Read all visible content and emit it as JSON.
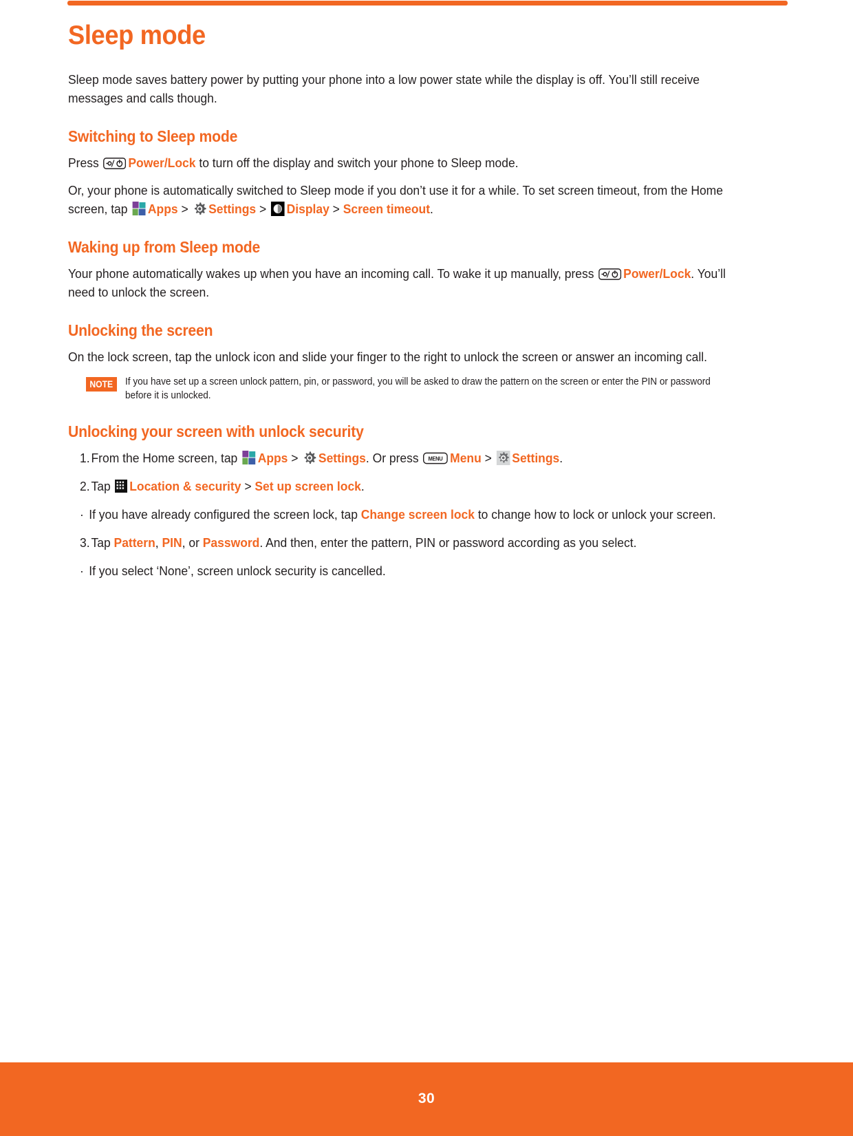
{
  "theme": {
    "accent": "#f26722",
    "text": "#231f20",
    "page_bg": "#ffffff"
  },
  "header": {
    "rule": "orange-top-rule"
  },
  "title": "Sleep mode",
  "intro": "Sleep mode saves battery power by putting your phone into a low power state while the display is off.  You’ll still receive messages and calls though.",
  "sections": [
    {
      "heading": "Switching to Sleep mode",
      "paragraphs": [
        {
          "id": "press-power",
          "before": "Press ",
          "icon": "power-lock-key-icon",
          "accent": "Power/Lock",
          "after": " to turn off the display and switch your phone to Sleep mode."
        },
        {
          "id": "auto-sleep",
          "lead": "Or, your phone is automatically switched to Sleep mode if you don’t use it for a while. To set screen timeout, from the Home screen, tap ",
          "path": [
            {
              "icon": "apps-grid-icon",
              "label": "Apps"
            },
            {
              "separator": ">"
            },
            {
              "icon": "settings-gear-icon",
              "label": "Settings"
            },
            {
              "separator": ">"
            },
            {
              "icon": "display-brightness-icon",
              "label": "Display"
            },
            {
              "separator": ">"
            },
            {
              "icon": null,
              "label": "Screen timeout"
            }
          ],
          "tail": "."
        }
      ]
    },
    {
      "heading": "Waking up from Sleep mode",
      "paragraphs": [
        {
          "id": "wake-up",
          "before": "Your phone automatically wakes up when you have an incoming call. To wake it up manually, press ",
          "icon": "power-lock-key-icon",
          "accent": "Power/Lock",
          "after": ". You’ll need to unlock the screen."
        }
      ]
    },
    {
      "heading": "Unlocking the screen",
      "paragraphs": [
        {
          "id": "lock-screen-slide",
          "text": "On the lock screen, tap the unlock icon and slide your finger to the right to unlock the screen or answer an incoming call."
        }
      ],
      "note": {
        "badge": "NOTE",
        "text": "If you have set up a screen unlock pattern, pin, or password, you will be asked to draw the pattern on the screen or enter the PIN or password before it is unlocked."
      }
    },
    {
      "heading": "Unlocking your screen with unlock security",
      "steps": [
        {
          "number": "1.",
          "lead": "From the Home screen, tap ",
          "parts": [
            {
              "icon": "apps-grid-icon",
              "label": "Apps"
            },
            {
              "separator": ">"
            },
            {
              "icon": "settings-gear-icon",
              "label": "Settings"
            }
          ],
          "mid": ". Or press ",
          "parts2": [
            {
              "icon": "menu-key-icon",
              "label": "Menu"
            },
            {
              "separator": ">"
            },
            {
              "icon": "settings-gear-grey-icon",
              "label": "Settings"
            }
          ],
          "tail": "."
        },
        {
          "number": "2.",
          "lead": "Tap ",
          "parts": [
            {
              "icon": "location-security-icon",
              "label": "Location & security"
            },
            {
              "separator": ">"
            },
            {
              "icon": null,
              "label": "Set up screen lock"
            }
          ],
          "tail": "."
        }
      ],
      "bullets_after_step2": [
        {
          "before": "If you have already configured the screen lock, tap ",
          "accent": "Change screen lock",
          "after": " to change how to lock or unlock your screen."
        }
      ],
      "step3": {
        "number": "3.",
        "lead": "Tap ",
        "accent1": "Pattern",
        "sep1": ", ",
        "accent2": "PIN",
        "sep2": ", or ",
        "accent3": "Password",
        "tail": ". And then, enter the pattern, PIN or password according as you select."
      },
      "bullets_after_step3": [
        {
          "before": "If you select ‘None’, screen unlock security is cancelled.",
          "accent": "",
          "after": ""
        }
      ]
    }
  ],
  "footer": {
    "page_number": "30"
  }
}
